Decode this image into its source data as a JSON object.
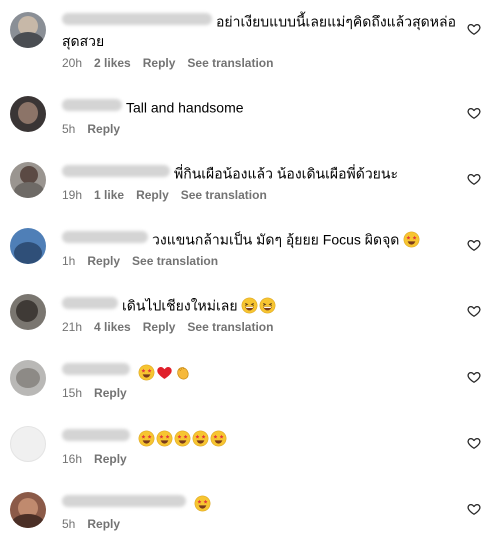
{
  "comments": [
    {
      "text": "อย่าเงียบแบบนี้เลยแม่ๆคิดถึงแล้วสุดหล่อ",
      "text2": "สุดสวย",
      "time": "20h",
      "likes": "2 likes",
      "reply": "Reply",
      "translate": "See translation",
      "uw": 150
    },
    {
      "text": "Tall and handsome",
      "time": "5h",
      "reply": "Reply",
      "uw": 60
    },
    {
      "text": "พี่กินเผือน้องแล้ว น้องเดินเผือพี่ด้วยนะ",
      "time": "19h",
      "likes": "1 like",
      "reply": "Reply",
      "translate": "See translation",
      "uw": 108
    },
    {
      "text": "วงแขนกล้ามเป็น มัดๆ อุ้ยยย Focus ผิดจุด",
      "time": "1h",
      "reply": "Reply",
      "translate": "See translation",
      "uw": 86
    },
    {
      "text": "เดินไปเชียงใหม่เลย",
      "time": "21h",
      "likes": "4 likes",
      "reply": "Reply",
      "translate": "See translation",
      "uw": 56
    },
    {
      "text": "",
      "time": "15h",
      "reply": "Reply",
      "uw": 68
    },
    {
      "text": "",
      "time": "16h",
      "reply": "Reply",
      "uw": 68
    },
    {
      "text": "",
      "time": "5h",
      "reply": "Reply",
      "uw": 124
    }
  ]
}
